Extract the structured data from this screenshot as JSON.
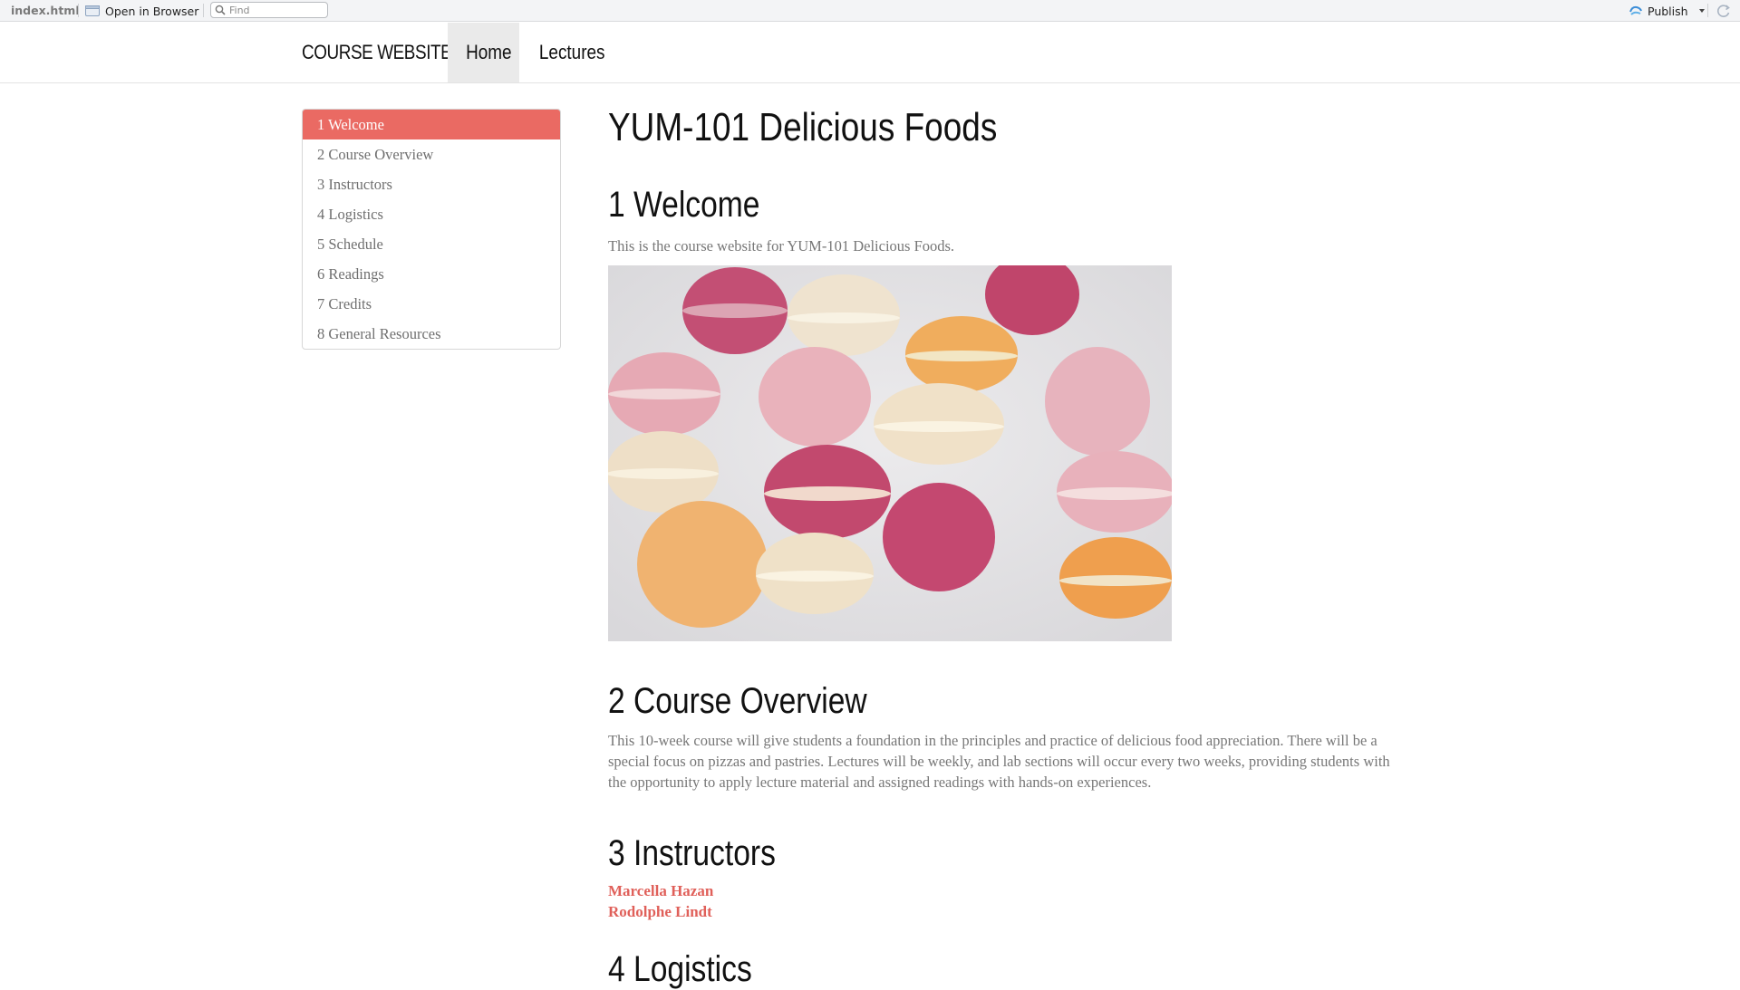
{
  "viewer": {
    "filename": "index.html",
    "open_in_browser": "Open in Browser",
    "find_placeholder": "Find",
    "publish": "Publish"
  },
  "site": {
    "brand": "COURSE WEBSITE",
    "nav": [
      "Home",
      "Lectures"
    ],
    "active_nav": "Home"
  },
  "toc": {
    "items": [
      "1 Welcome",
      "2 Course Overview",
      "3 Instructors",
      "4 Logistics",
      "5 Schedule",
      "6 Readings",
      "7 Credits",
      "8 General Resources"
    ],
    "active_index": 0
  },
  "content": {
    "title": "YUM-101 Delicious Foods",
    "sections": {
      "welcome": {
        "heading": "1 Welcome",
        "text": "This is the course website for YUM-101 Delicious Foods."
      },
      "overview": {
        "heading": "2 Course Overview",
        "text": "This 10-week course will give students a foundation in the principles and practice of delicious food appreciation. There will be a special focus on pizzas and pastries. Lectures will be weekly, and lab sections will occur every two weeks, providing students with the opportunity to apply lecture material and assigned readings with hands-on experiences."
      },
      "instructors": {
        "heading": "3 Instructors",
        "names": [
          "Marcella Hazan",
          "Rodolphe Lindt"
        ]
      },
      "logistics": {
        "heading": "4 Logistics"
      }
    }
  },
  "colors": {
    "accent": "#ea6a63",
    "link": "#e0605a",
    "body_text": "#777777"
  },
  "icons": [
    "browser-icon",
    "search-icon",
    "publish-icon",
    "dropdown-arrow-icon",
    "refresh-icon"
  ]
}
